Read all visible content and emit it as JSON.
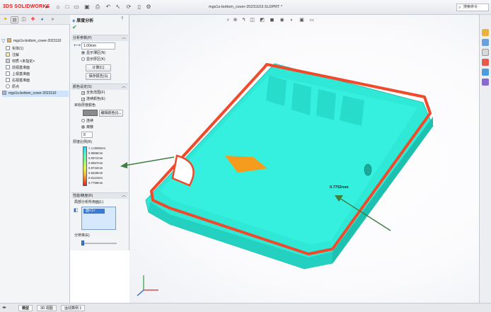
{
  "app": {
    "brand_ds": "3DS",
    "brand_name": "SOLIDWORKS",
    "document_title": "mgs1s-bottom_cover-20231103.SLDPRT *",
    "search_placeholder": "搜索命令"
  },
  "tree": {
    "root_label": "mgs1s-bottom_cover-2023110",
    "items": [
      {
        "label": "实体(1)"
      },
      {
        "label": "注解"
      },
      {
        "label": "材质 <未指定>"
      },
      {
        "label": "前视基准面"
      },
      {
        "label": "上视基准面"
      },
      {
        "label": "右视基准面"
      },
      {
        "label": "原点"
      }
    ],
    "bottom_label": "mgs1s-bottom_cover-2023110"
  },
  "property_manager": {
    "title": "厚度分析",
    "help_icon": "?",
    "analysis_params": {
      "header": "分析参数(P)",
      "target_thickness": "1.00mm",
      "show_thin": "显示薄区(N)",
      "show_thick": "显示厚区(K)",
      "calculate": "计算(C)",
      "save_report": "保存报告(S)"
    },
    "color_settings": {
      "header": "颜色设定(S)",
      "full_range": "全色范围(F)",
      "continuous": "连续颜色(E)",
      "target_color_label": "目标厚度颜色",
      "edit_color": "编辑颜色(I)...",
      "smooth": "连续",
      "discrete": "离散",
      "steps": "8"
    },
    "thickness_scale": {
      "header": "厚度比例(R)",
      "values": [
        "> 1.0000mm",
        "0.9686mm",
        "0.9371mm",
        "0.9057mm",
        "0.8742mm",
        "0.8428mm",
        "0.8113mm",
        "0.7799mm"
      ]
    },
    "performance": {
      "header": "性能/精度(R)",
      "local_analysis_label": "局部分析所用面(L)",
      "face_item": "面<1>",
      "resolution_label": "分辨率(E)"
    }
  },
  "viewport": {
    "thickness_readout": "0.7752mm",
    "model_colors": {
      "body": "#2fe8d6",
      "edge": "#f04a2a",
      "thin_patch": "#f59b1e"
    }
  },
  "bottom_tabs": [
    "模型",
    "3D 视图",
    "运动算例 1"
  ]
}
